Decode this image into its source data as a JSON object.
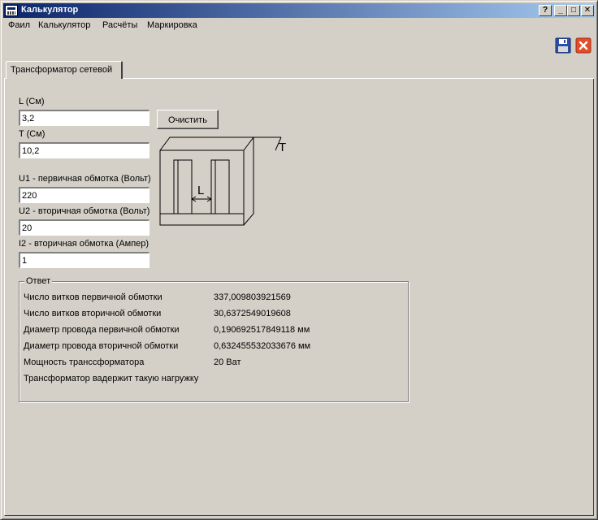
{
  "window": {
    "title": "Калькулятор"
  },
  "titlebar_buttons": {
    "help": "?",
    "minimize": "_",
    "maximize": "□",
    "close": "✕"
  },
  "menu": [
    "Фаил",
    "Калькулятор",
    "Расчёты",
    "Маркировка"
  ],
  "tabs": [
    {
      "label": "Трансформатор сетевой"
    }
  ],
  "fields": {
    "l": {
      "label": "L (См)",
      "value": "3,2"
    },
    "t": {
      "label": "T (См)",
      "value": "10,2"
    },
    "u1": {
      "label": "U1 - первичная обмотка (Вольт)",
      "value": "220"
    },
    "u2": {
      "label": "U2 - вторичная обмотка (Вольт)",
      "value": "20"
    },
    "i2": {
      "label": "I2 - вторичная обмотка (Ампер)",
      "value": "1"
    }
  },
  "clear_button": "Очистить",
  "diagram": {
    "label_t": "T",
    "label_l": "L"
  },
  "answer": {
    "title": "Ответ",
    "rows": [
      {
        "label": "Число витков первичной обмотки",
        "value": "337,009803921569"
      },
      {
        "label": "Число витков вторичной обмотки",
        "value": "30,6372549019608"
      },
      {
        "label": "Диаметр провода первичной обмотки",
        "value": "0,190692517849118 мм"
      },
      {
        "label": "Диаметр провода вторичной обмотки",
        "value": "0,632455532033676 мм"
      },
      {
        "label": "Мощность трансcформатора",
        "value": "20 Ват"
      },
      {
        "label": "Трансформатор вадержит такую нагружку",
        "value": ""
      }
    ]
  },
  "colors": {
    "face": "#d4d0c8",
    "title_start": "#0a246a",
    "title_end": "#a6caf0",
    "close_red": "#e24d2a",
    "save_blue": "#2a4fa8"
  },
  "icons": {
    "save": "floppy-disk-icon",
    "exit": "close-icon"
  }
}
